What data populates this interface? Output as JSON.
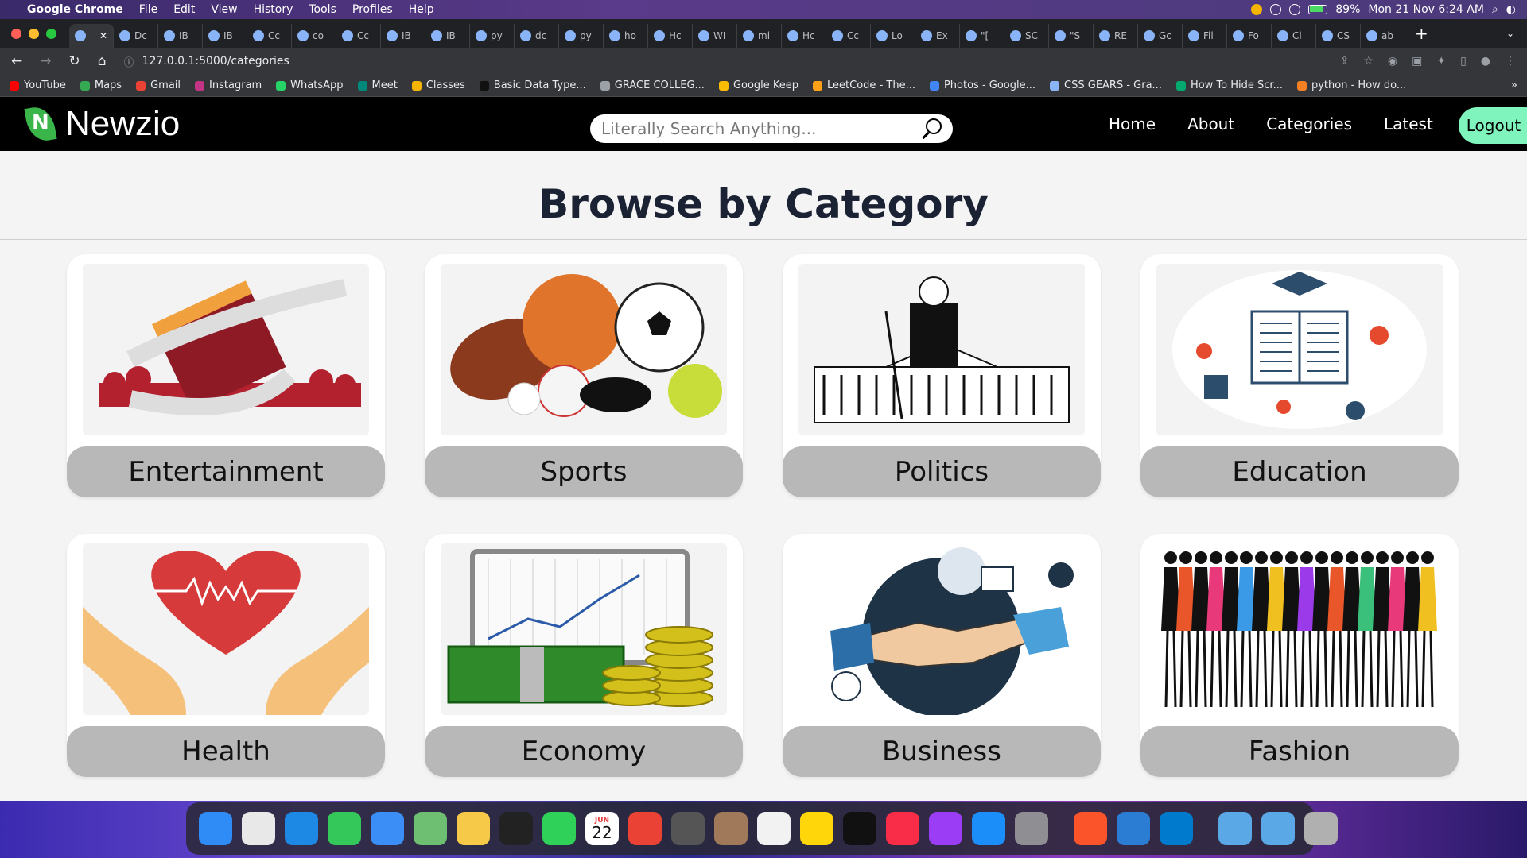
{
  "menubar": {
    "app": "Google Chrome",
    "items": [
      "File",
      "Edit",
      "View",
      "History",
      "Tools",
      "Profiles",
      "Help"
    ],
    "battery": "89%",
    "datetime": "Mon 21 Nov 6:24 AM"
  },
  "tabs": [
    {
      "label": "Dc"
    },
    {
      "label": "IB"
    },
    {
      "label": "IB"
    },
    {
      "label": "Cc"
    },
    {
      "label": "co"
    },
    {
      "label": "Cc"
    },
    {
      "label": "IB"
    },
    {
      "label": "IB"
    },
    {
      "label": "py"
    },
    {
      "label": "dc"
    },
    {
      "label": "py"
    },
    {
      "label": "ho"
    },
    {
      "label": "Hc"
    },
    {
      "label": "WI"
    },
    {
      "label": "mi"
    },
    {
      "label": "Hc"
    },
    {
      "label": "Cc"
    },
    {
      "label": "Lo"
    },
    {
      "label": "Ex"
    },
    {
      "label": "\"["
    },
    {
      "label": "SC"
    },
    {
      "label": "\"S"
    },
    {
      "label": "RE"
    },
    {
      "label": "Gc"
    },
    {
      "label": "Fil"
    },
    {
      "label": "Fo"
    },
    {
      "label": "Cl"
    },
    {
      "label": "CS"
    },
    {
      "label": "ab"
    }
  ],
  "address": {
    "url": "127.0.0.1:5000/categories"
  },
  "bookmarks": [
    {
      "label": "YouTube",
      "color": "#ff0000"
    },
    {
      "label": "Maps",
      "color": "#34a853"
    },
    {
      "label": "Gmail",
      "color": "#ea4335"
    },
    {
      "label": "Instagram",
      "color": "#c13584"
    },
    {
      "label": "WhatsApp",
      "color": "#25d366"
    },
    {
      "label": "Meet",
      "color": "#00897b"
    },
    {
      "label": "Classes",
      "color": "#f4b400"
    },
    {
      "label": "Basic Data Type...",
      "color": "#111111"
    },
    {
      "label": "GRACE COLLEG...",
      "color": "#9aa0a6"
    },
    {
      "label": "Google Keep",
      "color": "#fbbc04"
    },
    {
      "label": "LeetCode - The...",
      "color": "#ffa116"
    },
    {
      "label": "Photos - Google...",
      "color": "#4285f4"
    },
    {
      "label": "CSS GEARS - Gra...",
      "color": "#8ab4f8"
    },
    {
      "label": "How To Hide Scr...",
      "color": "#04aa6d"
    },
    {
      "label": "python - How do...",
      "color": "#f48024"
    }
  ],
  "site": {
    "brand": "Newzio",
    "search_placeholder": "Literally Search Anything...",
    "nav": [
      "Home",
      "About",
      "Categories",
      "Latest"
    ],
    "logout": "Logout"
  },
  "page": {
    "title": "Browse by Category",
    "categories": [
      {
        "label": "Entertainment",
        "icon": "film-reel-icon"
      },
      {
        "label": "Sports",
        "icon": "sports-balls-icon"
      },
      {
        "label": "Politics",
        "icon": "capitol-figure-icon"
      },
      {
        "label": "Education",
        "icon": "open-book-icon"
      },
      {
        "label": "Health",
        "icon": "heart-hands-icon"
      },
      {
        "label": "Economy",
        "icon": "money-chart-icon"
      },
      {
        "label": "Business",
        "icon": "handshake-icon"
      },
      {
        "label": "Fashion",
        "icon": "fashion-silhouettes-icon"
      }
    ]
  },
  "dock": {
    "apps": [
      {
        "name": "finder-icon",
        "color": "#2f8bf5"
      },
      {
        "name": "launchpad-icon",
        "color": "#e8e8e8"
      },
      {
        "name": "safari-icon",
        "color": "#1e88e5"
      },
      {
        "name": "messages-icon",
        "color": "#34c759"
      },
      {
        "name": "mail-icon",
        "color": "#3a8ef6"
      },
      {
        "name": "maps-icon",
        "color": "#6fbf73"
      },
      {
        "name": "photos-icon",
        "color": "#f7c948"
      },
      {
        "name": "voice-memos-icon",
        "color": "#222222"
      },
      {
        "name": "facetime-icon",
        "color": "#30d158"
      },
      {
        "name": "calendar-icon",
        "color": "#ffffff"
      },
      {
        "name": "chrome-icon",
        "color": "#ea4335"
      },
      {
        "name": "screenshot-icon",
        "color": "#555555"
      },
      {
        "name": "contacts-icon",
        "color": "#a0785a"
      },
      {
        "name": "reminders-icon",
        "color": "#f2f2f2"
      },
      {
        "name": "notes-icon",
        "color": "#ffd60a"
      },
      {
        "name": "tv-icon",
        "color": "#111111"
      },
      {
        "name": "music-icon",
        "color": "#fa2d48"
      },
      {
        "name": "podcasts-icon",
        "color": "#9b3df5"
      },
      {
        "name": "app-store-icon",
        "color": "#1c8ef9"
      },
      {
        "name": "system-settings-icon",
        "color": "#8e8e93"
      },
      {
        "name": "brave-icon",
        "color": "#fb542b"
      },
      {
        "name": "copilot-icon",
        "color": "#2b7cd3"
      },
      {
        "name": "vscode-icon",
        "color": "#007acc"
      },
      {
        "name": "downloads-icon",
        "color": "#5aa9e6"
      },
      {
        "name": "folder-icon",
        "color": "#5aa9e6"
      },
      {
        "name": "trash-icon",
        "color": "#b0b0b0"
      }
    ],
    "calendar_month": "JUN",
    "calendar_day": "22"
  }
}
